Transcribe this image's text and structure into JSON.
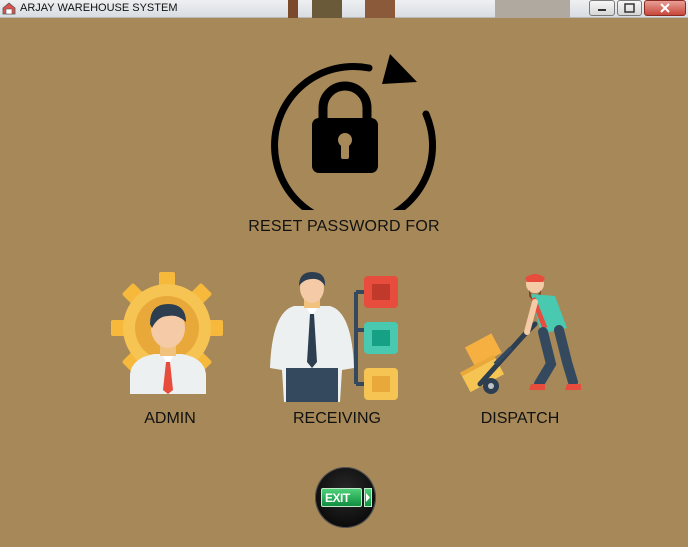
{
  "window": {
    "title": "ARJAY WAREHOUSE SYSTEM",
    "controls": [
      "minimize-icon",
      "maximize-icon",
      "close-icon"
    ]
  },
  "main": {
    "heading": "RESET PASSWORD FOR",
    "icon": "lock-refresh-icon",
    "roles": [
      {
        "label": "ADMIN",
        "icon": "admin-gear-person-icon"
      },
      {
        "label": "RECEIVING",
        "icon": "receiving-person-checklist-icon"
      },
      {
        "label": "DISPATCH",
        "icon": "dispatch-hand-truck-icon"
      }
    ],
    "exit_label": "EXIT"
  },
  "colors": {
    "background": "#a78858",
    "exit_green": "#1fae55"
  }
}
